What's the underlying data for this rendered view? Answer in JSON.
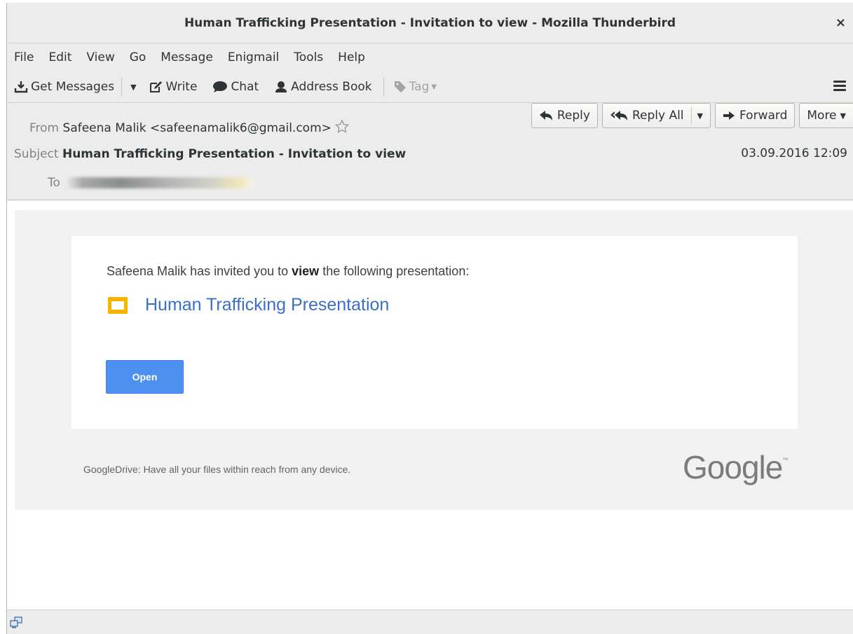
{
  "window": {
    "title": "Human Trafficking Presentation - Invitation to view - Mozilla Thunderbird",
    "close_glyph": "×"
  },
  "menubar": [
    {
      "label": "File"
    },
    {
      "label": "Edit"
    },
    {
      "label": "View"
    },
    {
      "label": "Go"
    },
    {
      "label": "Message"
    },
    {
      "label": "Enigmail"
    },
    {
      "label": "Tools"
    },
    {
      "label": "Help"
    }
  ],
  "toolbar": {
    "get_messages": "Get Messages",
    "write": "Write",
    "chat": "Chat",
    "address_book": "Address Book",
    "tag": "Tag",
    "menu_icon": "hamburger-icon"
  },
  "header": {
    "from_label": "From",
    "from_value": "Safeena Malik <safeenamalik6@gmail.com>",
    "subject_label": "Subject",
    "subject_value": "Human Trafficking Presentation - Invitation to view",
    "to_label": "To",
    "date": "03.09.2016 12:09",
    "buttons": {
      "reply": "Reply",
      "reply_all": "Reply All",
      "forward": "Forward",
      "more": "More"
    }
  },
  "message": {
    "invite_before": "Safeena Malik has invited you to ",
    "invite_bold": "view",
    "invite_after": " the following presentation:",
    "doc_title": "Human Trafficking Presentation",
    "open_label": "Open",
    "footer_text": "GoogleDrive: Have all your files within reach from any device.",
    "google_logo": "Google",
    "google_tm": "™"
  },
  "colors": {
    "link": "#3a6fc4",
    "open_button": "#4d90f0",
    "slides_icon": "#f4b400"
  }
}
